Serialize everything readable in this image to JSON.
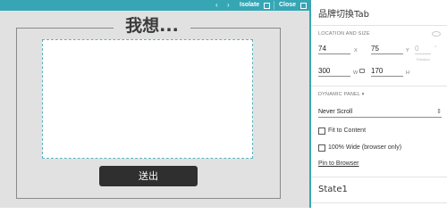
{
  "editbar": {
    "isolate": "Isolate",
    "close": "Close"
  },
  "canvas": {
    "title": "我想...",
    "send_button": "送出"
  },
  "inspector": {
    "title": "品牌切換Tab",
    "location_section": "LOCATION AND SIZE",
    "x": {
      "value": "74",
      "label": "X"
    },
    "y": {
      "value": "75",
      "label": "Y"
    },
    "rotation": {
      "value": "0",
      "label": "Rotation",
      "degree": "°"
    },
    "w": {
      "value": "300",
      "label": "W"
    },
    "h": {
      "value": "170",
      "label": "H"
    },
    "dynamic_panel_section": "DYNAMIC PANEL ▾",
    "scroll_select": "Never Scroll",
    "fit_to_content": "Fit to Content",
    "wide_browser": "100% Wide (browser only)",
    "pin_to_browser": "Pin to Browser",
    "state": "State1"
  },
  "colors": {
    "accent": "#36a6b4",
    "button": "#2f2f2f",
    "canvas_bg": "#e1e1e1"
  }
}
